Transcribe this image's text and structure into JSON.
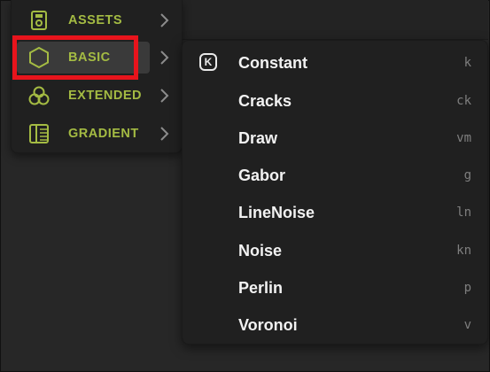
{
  "categories": [
    {
      "label": "ASSETS",
      "icon": "asset-file-icon"
    },
    {
      "label": "BASIC",
      "icon": "hexagon-icon"
    },
    {
      "label": "EXTENDED",
      "icon": "triple-circle-icon"
    },
    {
      "label": "GRADIENT",
      "icon": "gradient-square-icon"
    }
  ],
  "active_category": "BASIC",
  "submenu": {
    "items": [
      {
        "label": "Constant",
        "shortcut": "k",
        "badge": "K"
      },
      {
        "label": "Cracks",
        "shortcut": "ck"
      },
      {
        "label": "Draw",
        "shortcut": "vm"
      },
      {
        "label": "Gabor",
        "shortcut": "g"
      },
      {
        "label": "LineNoise",
        "shortcut": "ln"
      },
      {
        "label": "Noise",
        "shortcut": "kn"
      },
      {
        "label": "Perlin",
        "shortcut": "p"
      },
      {
        "label": "Voronoi",
        "shortcut": "v"
      }
    ]
  },
  "colors": {
    "accent": "#a4bb43",
    "highlight": "#e8141c",
    "menu_bg": "#202020",
    "text": "#f2f2f2",
    "shortcut": "#7f7f7f"
  }
}
